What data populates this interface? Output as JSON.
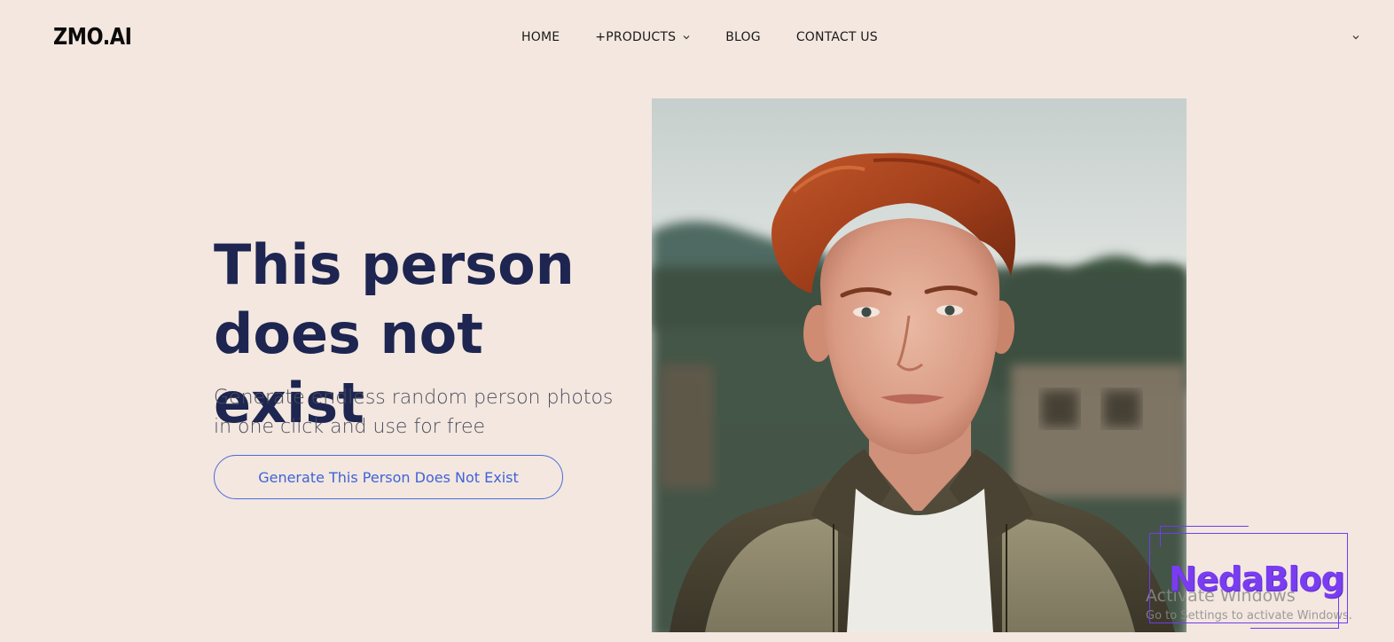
{
  "header": {
    "logo": "ZMO.AI",
    "nav": {
      "home": "HOME",
      "products": "+PRODUCTS",
      "blog": "BLOG",
      "contact": "CONTACT US"
    }
  },
  "hero": {
    "title_line1": "This person",
    "title_line2": "does not exist",
    "subtitle_line1": "Generate endless random person photos",
    "subtitle_line2": "in one click and use for free",
    "cta_label": "Generate This Person Does Not Exist"
  },
  "overlay": {
    "activate_title": "Activate Windows",
    "activate_sub": "Go to Settings to activate Windows.",
    "watermark": "NedaBlog"
  },
  "colors": {
    "background": "#f3e7df",
    "title": "#1d2550",
    "accent": "#3f63d8",
    "watermark": "#7a3cf0"
  }
}
